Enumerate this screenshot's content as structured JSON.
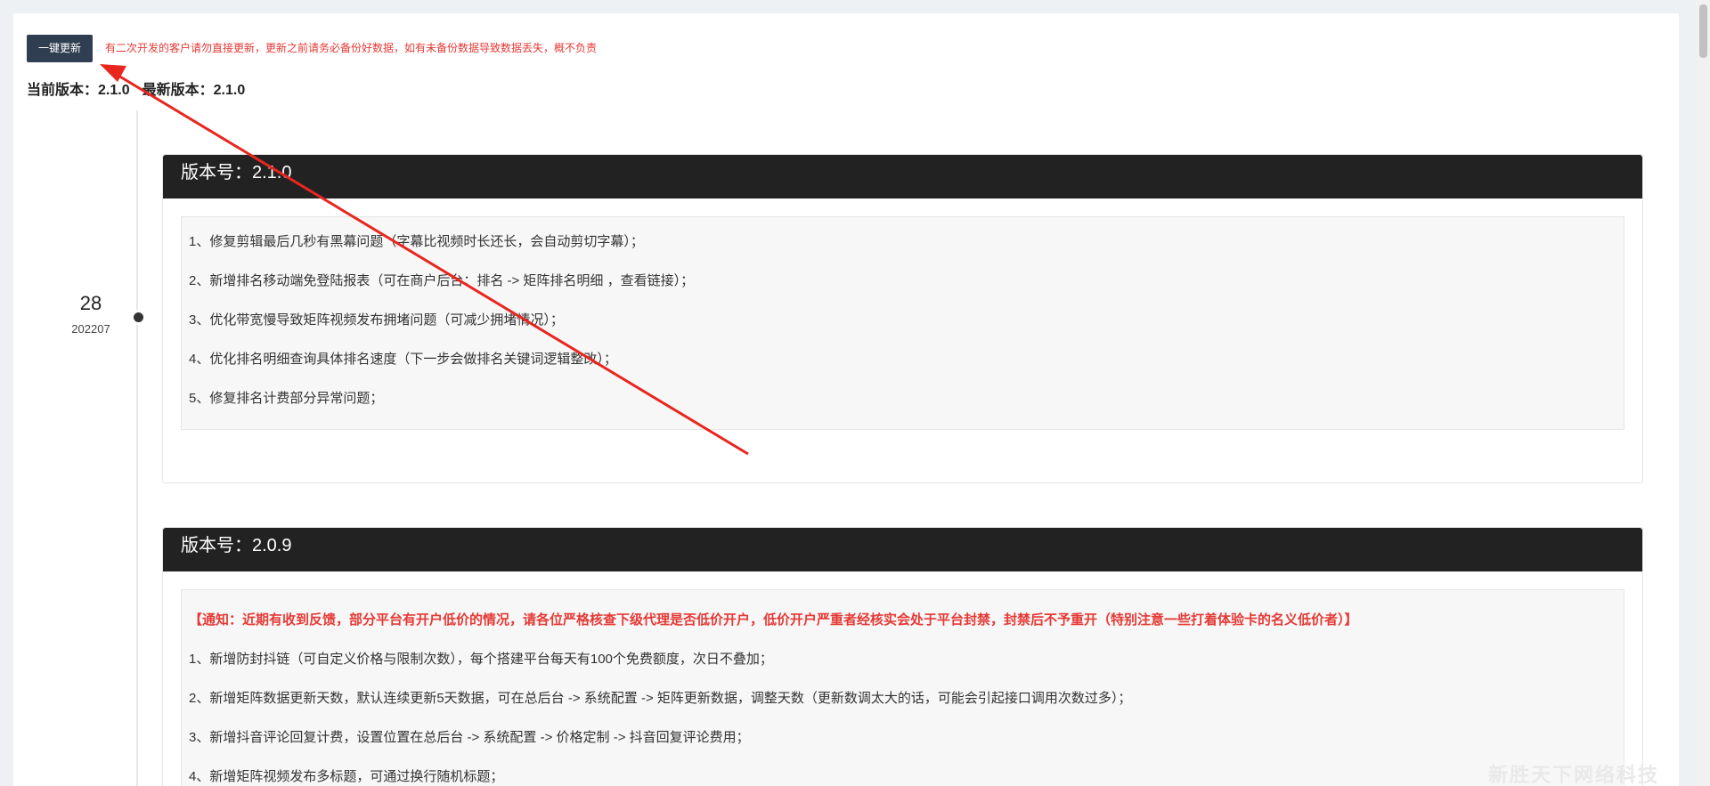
{
  "toolbar": {
    "update_button_label": "一键更新",
    "warning_text": "有二次开发的客户请勿直接更新，更新之前请务必备份好数据，如有未备份数据导致数据丢失，概不负责"
  },
  "version_info": {
    "current_label": "当前版本：",
    "current_value": "2.1.0",
    "latest_label": "最新版本：",
    "latest_value": "2.1.0"
  },
  "timeline": {
    "date_day": "28",
    "date_sub": "202207"
  },
  "releases": [
    {
      "title": "版本号：2.1.0",
      "items": [
        "1、修复剪辑最后几秒有黑幕问题（字幕比视频时长还长，会自动剪切字幕）；",
        "2、新增排名移动端免登陆报表（可在商户后台：排名 -> 矩阵排名明细 ，查看链接）；",
        "3、优化带宽慢导致矩阵视频发布拥堵问题（可减少拥堵情况）；",
        "4、优化排名明细查询具体排名速度（下一步会做排名关键词逻辑整改）；",
        "5、修复排名计费部分异常问题；"
      ]
    },
    {
      "title": "版本号：2.0.9",
      "notice": "【通知：近期有收到反馈，部分平台有开户低价的情况，请各位严格核查下级代理是否低价开户，低价开户严重者经核实会处于平台封禁，封禁后不予重开（特别注意一些打着体验卡的名义低价者）】",
      "items": [
        "1、新增防封抖链（可自定义价格与限制次数），每个搭建平台每天有100个免费额度，次日不叠加；",
        "2、新增矩阵数据更新天数，默认连续更新5天数据，可在总后台 -> 系统配置 -> 矩阵更新数据，调整天数（更新数调太大的话，可能会引起接口调用次数过多）；",
        "3、新增抖音评论回复计费，设置位置在总后台 -> 系统配置 -> 价格定制 -> 抖音回复评论费用；",
        "4、新增矩阵视频发布多标题，可通过换行随机标题；"
      ]
    }
  ],
  "watermark": "新胜天下网络科技",
  "colors": {
    "button_bg": "#2f3e50",
    "warning": "#e53935",
    "card_header_bg": "#222222",
    "annotation_arrow": "#e8261f"
  }
}
